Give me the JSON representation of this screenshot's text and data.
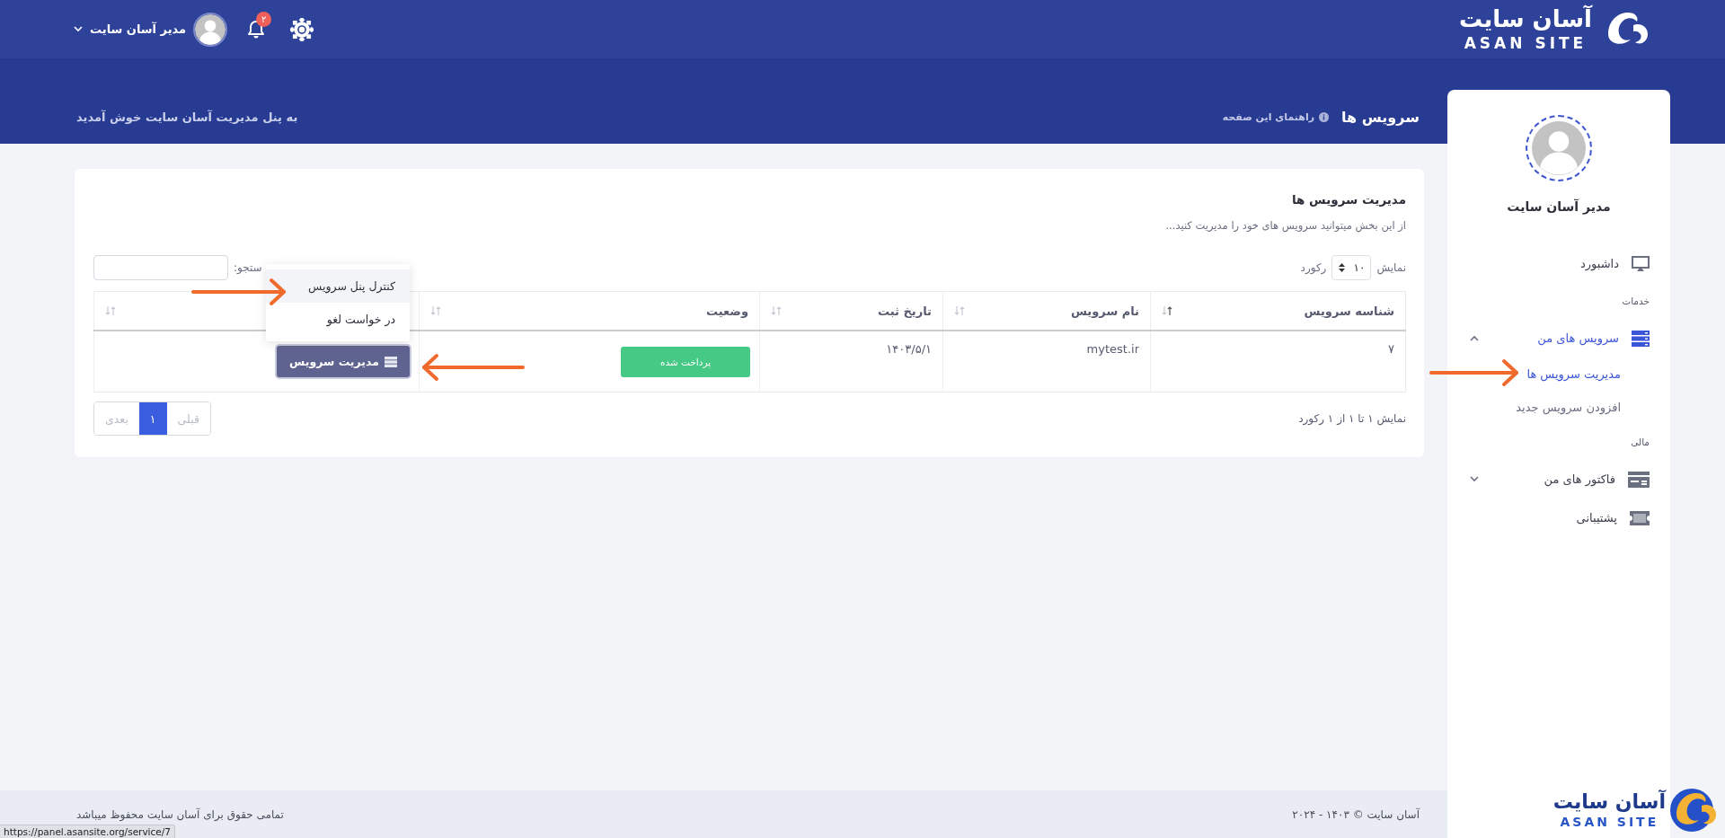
{
  "header": {
    "logo": {
      "name": "آسان سایت",
      "latin": "ASAN SITE"
    },
    "notifications": {
      "count": "۲"
    },
    "user": {
      "name": "مدیر آسان سایت"
    },
    "page_title": "سرویس ها",
    "help_link": "راهنمای این صفحه",
    "welcome": "به پنل مدیریت آسان سایت خوش آمدید"
  },
  "sidebar": {
    "user_name": "مدیر آسان سایت",
    "items": [
      {
        "kind": "link",
        "label": "داشبورد",
        "selected": false
      },
      {
        "kind": "section",
        "label": "خدمات"
      },
      {
        "kind": "group",
        "label": "سرویس های من",
        "selected": true,
        "expanded": true,
        "children": [
          {
            "label": "مدیریت سرویس ها",
            "selected": true
          },
          {
            "label": "افزودن سرویس جدید",
            "selected": false
          }
        ]
      },
      {
        "kind": "section",
        "label": "مالی"
      },
      {
        "kind": "group",
        "label": "فاکتور های من",
        "selected": false,
        "expanded": false
      },
      {
        "kind": "link",
        "label": "پشتیبانی",
        "selected": false
      }
    ]
  },
  "card": {
    "title": "مدیریت سرویس ها",
    "description": "از این بخش میتوانید سرویس های خود را مدیریت کنید...",
    "length_control": {
      "prefix": "نمایش",
      "value": "۱۰",
      "suffix": "رکورد"
    },
    "search": {
      "label": "ستجو:"
    },
    "table": {
      "columns": [
        {
          "label": "شناسه سرویس",
          "sorted": true
        },
        {
          "label": "نام سرویس",
          "sorted": false
        },
        {
          "label": "تاریخ ثبت",
          "sorted": false
        },
        {
          "label": "وضعیت",
          "sorted": false
        },
        {
          "sorted": false
        }
      ],
      "rows": [
        {
          "id": "۷",
          "name": "mytest.ir",
          "date": "۱۴۰۳/۵/۱",
          "status": "پرداخت شده",
          "action": {
            "label": "مدیریت سرویس",
            "expanded": true,
            "menu": [
              {
                "label": "کنترل پنل سرویس",
                "selected": true
              },
              {
                "label": "در خواست لغو",
                "selected": false
              }
            ]
          }
        }
      ]
    },
    "info": "نمایش ۱ تا ۱ از ۱ رکورد",
    "pagination": [
      {
        "label": "قبلی",
        "selected": false,
        "disabled": true
      },
      {
        "label": "۱",
        "selected": true,
        "disabled": false
      },
      {
        "label": "بعدی",
        "selected": false,
        "disabled": true
      }
    ]
  },
  "footer": {
    "copyright": "آسان سایت © ۱۴۰۳ - ۲۰۲۴",
    "rights": "تمامی حقوق برای آسان سایت محفوظ میباشد",
    "logo": {
      "name": "آسان سایت",
      "latin": "ASAN SITE"
    }
  },
  "status_url": "https://panel.asansite.org/service/7"
}
